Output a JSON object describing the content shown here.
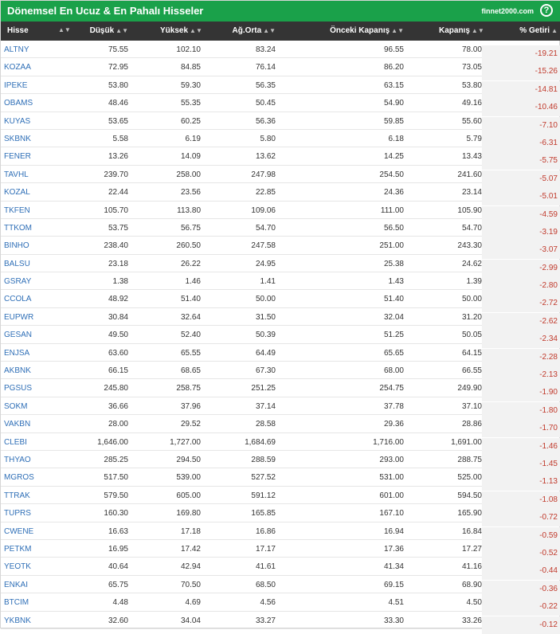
{
  "header": {
    "title": "Dönemsel En Ucuz & En Pahalı Hisseler",
    "brand": "finnet2000.com",
    "help": "?"
  },
  "table": {
    "columns": [
      "Hisse",
      "Düşük",
      "Yüksek",
      "Ağ.Orta",
      "Önceki Kapanış",
      "Kapanış",
      "% Getiri"
    ],
    "sort_icon": "sort-icon",
    "rows": [
      [
        "ALTNY",
        "75.55",
        "102.10",
        "83.24",
        "96.55",
        "78.00",
        "-19.21"
      ],
      [
        "KOZAA",
        "72.95",
        "84.85",
        "76.14",
        "86.20",
        "73.05",
        "-15.26"
      ],
      [
        "IPEKE",
        "53.80",
        "59.30",
        "56.35",
        "63.15",
        "53.80",
        "-14.81"
      ],
      [
        "OBAMS",
        "48.46",
        "55.35",
        "50.45",
        "54.90",
        "49.16",
        "-10.46"
      ],
      [
        "KUYAS",
        "53.65",
        "60.25",
        "56.36",
        "59.85",
        "55.60",
        "-7.10"
      ],
      [
        "SKBNK",
        "5.58",
        "6.19",
        "5.80",
        "6.18",
        "5.79",
        "-6.31"
      ],
      [
        "FENER",
        "13.26",
        "14.09",
        "13.62",
        "14.25",
        "13.43",
        "-5.75"
      ],
      [
        "TAVHL",
        "239.70",
        "258.00",
        "247.98",
        "254.50",
        "241.60",
        "-5.07"
      ],
      [
        "KOZAL",
        "22.44",
        "23.56",
        "22.85",
        "24.36",
        "23.14",
        "-5.01"
      ],
      [
        "TKFEN",
        "105.70",
        "113.80",
        "109.06",
        "111.00",
        "105.90",
        "-4.59"
      ],
      [
        "TTKOM",
        "53.75",
        "56.75",
        "54.70",
        "56.50",
        "54.70",
        "-3.19"
      ],
      [
        "BINHO",
        "238.40",
        "260.50",
        "247.58",
        "251.00",
        "243.30",
        "-3.07"
      ],
      [
        "BALSU",
        "23.18",
        "26.22",
        "24.95",
        "25.38",
        "24.62",
        "-2.99"
      ],
      [
        "GSRAY",
        "1.38",
        "1.46",
        "1.41",
        "1.43",
        "1.39",
        "-2.80"
      ],
      [
        "CCOLA",
        "48.92",
        "51.40",
        "50.00",
        "51.40",
        "50.00",
        "-2.72"
      ],
      [
        "EUPWR",
        "30.84",
        "32.64",
        "31.50",
        "32.04",
        "31.20",
        "-2.62"
      ],
      [
        "GESAN",
        "49.50",
        "52.40",
        "50.39",
        "51.25",
        "50.05",
        "-2.34"
      ],
      [
        "ENJSA",
        "63.60",
        "65.55",
        "64.49",
        "65.65",
        "64.15",
        "-2.28"
      ],
      [
        "AKBNK",
        "66.15",
        "68.65",
        "67.30",
        "68.00",
        "66.55",
        "-2.13"
      ],
      [
        "PGSUS",
        "245.80",
        "258.75",
        "251.25",
        "254.75",
        "249.90",
        "-1.90"
      ],
      [
        "SOKM",
        "36.66",
        "37.96",
        "37.14",
        "37.78",
        "37.10",
        "-1.80"
      ],
      [
        "VAKBN",
        "28.00",
        "29.52",
        "28.58",
        "29.36",
        "28.86",
        "-1.70"
      ],
      [
        "CLEBI",
        "1,646.00",
        "1,727.00",
        "1,684.69",
        "1,716.00",
        "1,691.00",
        "-1.46"
      ],
      [
        "THYAO",
        "285.25",
        "294.50",
        "288.59",
        "293.00",
        "288.75",
        "-1.45"
      ],
      [
        "MGROS",
        "517.50",
        "539.00",
        "527.52",
        "531.00",
        "525.00",
        "-1.13"
      ],
      [
        "TTRAK",
        "579.50",
        "605.00",
        "591.12",
        "601.00",
        "594.50",
        "-1.08"
      ],
      [
        "TUPRS",
        "160.30",
        "169.80",
        "165.85",
        "167.10",
        "165.90",
        "-0.72"
      ],
      [
        "CWENE",
        "16.63",
        "17.18",
        "16.86",
        "16.94",
        "16.84",
        "-0.59"
      ],
      [
        "PETKM",
        "16.95",
        "17.42",
        "17.17",
        "17.36",
        "17.27",
        "-0.52"
      ],
      [
        "YEOTK",
        "40.64",
        "42.94",
        "41.61",
        "41.34",
        "41.16",
        "-0.44"
      ],
      [
        "ENKAI",
        "65.75",
        "70.50",
        "68.50",
        "69.15",
        "68.90",
        "-0.36"
      ],
      [
        "BTCIM",
        "4.48",
        "4.69",
        "4.56",
        "4.51",
        "4.50",
        "-0.22"
      ],
      [
        "YKBNK",
        "32.60",
        "34.04",
        "33.27",
        "33.30",
        "33.26",
        "-0.12"
      ]
    ]
  }
}
